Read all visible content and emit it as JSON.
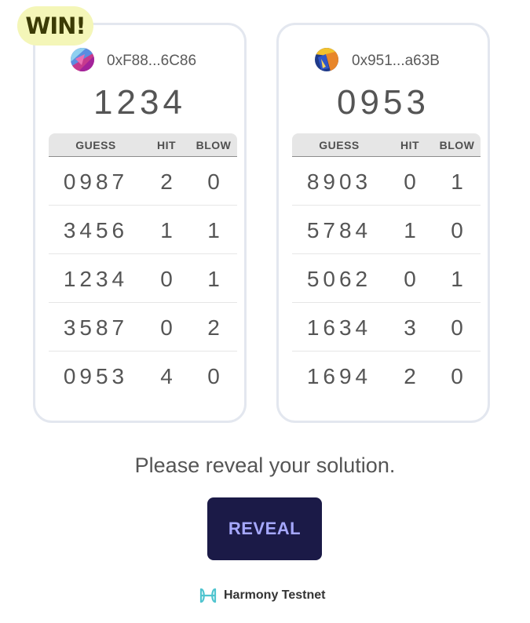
{
  "winner_badge": "WIN!",
  "players": [
    {
      "address": "0xF88...6C86",
      "avatar": "gradient-avatar-pink-blue",
      "secret": "1234",
      "table_headers": {
        "guess": "GUESS",
        "hit": "HIT",
        "blow": "BLOW"
      },
      "rows": [
        {
          "guess": "0987",
          "hit": "2",
          "blow": "0"
        },
        {
          "guess": "3456",
          "hit": "1",
          "blow": "1"
        },
        {
          "guess": "1234",
          "hit": "0",
          "blow": "1"
        },
        {
          "guess": "3587",
          "hit": "0",
          "blow": "2"
        },
        {
          "guess": "0953",
          "hit": "4",
          "blow": "0"
        }
      ]
    },
    {
      "address": "0x951...a63B",
      "avatar": "gradient-avatar-yellow-navy",
      "secret": "0953",
      "table_headers": {
        "guess": "GUESS",
        "hit": "HIT",
        "blow": "BLOW"
      },
      "rows": [
        {
          "guess": "8903",
          "hit": "0",
          "blow": "1"
        },
        {
          "guess": "5784",
          "hit": "1",
          "blow": "0"
        },
        {
          "guess": "5062",
          "hit": "0",
          "blow": "1"
        },
        {
          "guess": "1634",
          "hit": "3",
          "blow": "0"
        },
        {
          "guess": "1694",
          "hit": "2",
          "blow": "0"
        }
      ]
    }
  ],
  "message": "Please reveal your solution.",
  "reveal_button": "REVEAL",
  "network": {
    "label": "Harmony Testnet",
    "icon": "harmony-logo-icon"
  },
  "colors": {
    "button_bg": "#1b1a47",
    "button_text": "#a6a8ff",
    "badge_bg": "#f4f6b8",
    "card_border": "#e3e7ef"
  }
}
